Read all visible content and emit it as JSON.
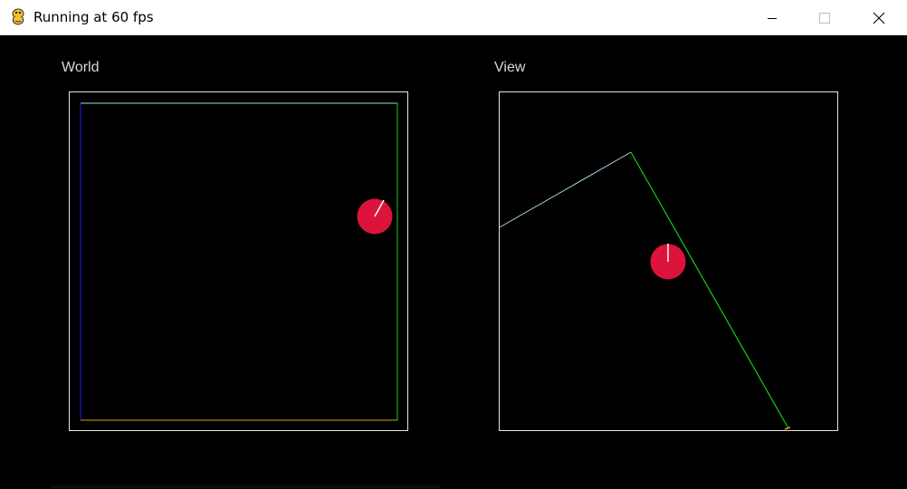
{
  "window": {
    "title": "Running at 60 fps",
    "app_icon": "pygame-snake-icon",
    "controls": {
      "minimize_icon": "minimize-icon",
      "maximize_icon": "maximize-icon",
      "close_icon": "close-icon"
    }
  },
  "panels": {
    "world": {
      "label": "World"
    },
    "view": {
      "label": "View"
    }
  },
  "colors": {
    "background": "#000000",
    "frame": "#e6e6e6",
    "wall_top": "#a8d8ea",
    "wall_left": "#1a1aff",
    "wall_right": "#19cc19",
    "wall_bottom": "#d9a800",
    "player": "#dc143c",
    "direction": "#ffffff",
    "label": "#d8d8d8"
  }
}
